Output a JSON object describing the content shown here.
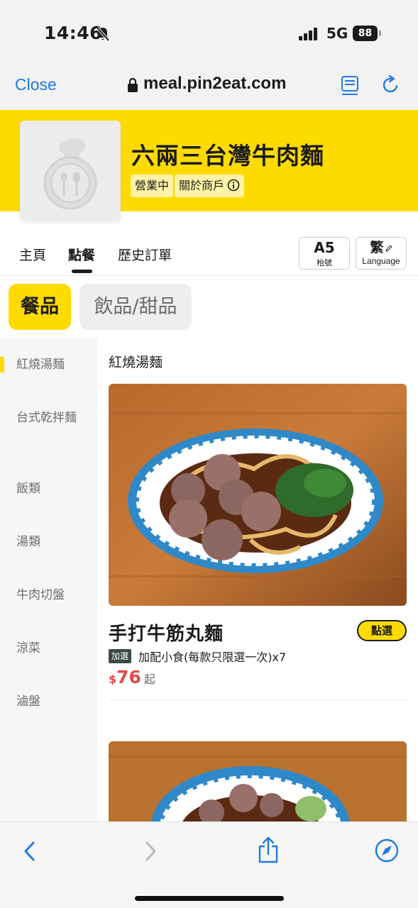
{
  "status_bar": {
    "time": "14:46",
    "network": "5G",
    "battery": "88"
  },
  "browser": {
    "close_label": "Close",
    "url": "meal.pin2eat.com"
  },
  "store": {
    "name": "六兩三台灣牛肉麵",
    "status": "營業中",
    "about": "關於商戶"
  },
  "nav": {
    "tabs": [
      "主頁",
      "點餐",
      "歷史訂單"
    ],
    "active_tab": "點餐",
    "table_number": "A5",
    "table_label": "枱號",
    "language_char": "繁",
    "language_label": "Language"
  },
  "category_pills": {
    "food": "餐品",
    "drinks": "飲品/甜品"
  },
  "sidebar": {
    "items": [
      "紅燒湯麵",
      "台式乾拌麵",
      "飯類",
      "湯類",
      "牛肉切盤",
      "涼菜",
      "滷盤"
    ],
    "active": "紅燒湯麵"
  },
  "menu": {
    "section_title": "紅燒湯麵",
    "items": [
      {
        "name": "手打牛筋丸麵",
        "order_label": "點選",
        "addon_tag": "加選",
        "addon_text": "加配小食(每款只限選一次)x7",
        "currency": "$",
        "price": "76",
        "price_suffix": "起"
      }
    ]
  },
  "colors": {
    "brand_yellow": "#fedb00",
    "link_blue": "#1f7ae0",
    "price_red": "#e24a4a"
  }
}
